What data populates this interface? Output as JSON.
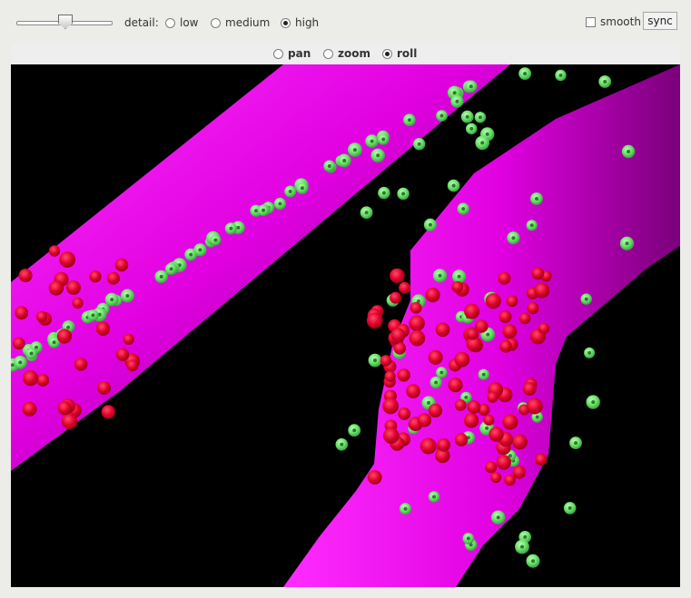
{
  "toolbar": {
    "detail_label": "detail:",
    "detail_options": [
      {
        "label": "low",
        "selected": false
      },
      {
        "label": "medium",
        "selected": false
      },
      {
        "label": "high",
        "selected": true
      }
    ],
    "slider_value_fraction": 0.5,
    "smooth_label": "smooth",
    "smooth_checked": false,
    "sync_label": "sync"
  },
  "mode_bar": {
    "options": [
      {
        "label": "pan",
        "selected": false
      },
      {
        "label": "zoom",
        "selected": false
      },
      {
        "label": "roll",
        "selected": true
      }
    ]
  },
  "scene": {
    "background_color": "#000000",
    "tube_color": "#e000e0",
    "tube_shadow_color": "#7a007a",
    "green_particle_color": "#6ee26e",
    "red_particle_color": "#e0002a"
  }
}
